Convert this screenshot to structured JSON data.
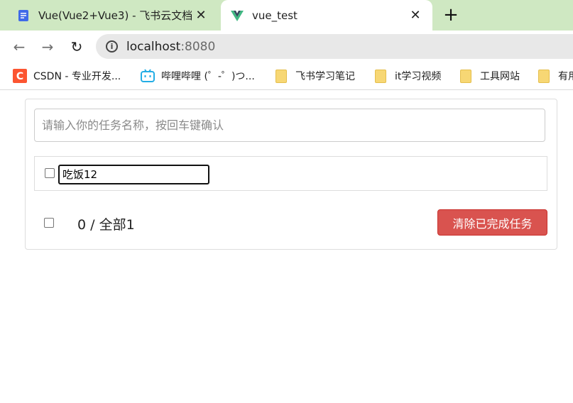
{
  "browser": {
    "tabs": [
      {
        "title": "Vue(Vue2+Vue3) - 飞书云文档",
        "close": "✕",
        "active": false
      },
      {
        "title": "vue_test",
        "close": "✕",
        "active": true
      }
    ],
    "new_tab": "+",
    "nav": {
      "back": "←",
      "forward": "→",
      "reload": "↻"
    },
    "url": {
      "host": "localhost",
      "port": ":8080"
    },
    "bookmarks": [
      {
        "label": "CSDN - 专业开发...",
        "icon": "csdn-icon"
      },
      {
        "label": "哔哩哔哩 (゜-゜)つ...",
        "icon": "bilibili-icon"
      },
      {
        "label": "飞书学习笔记",
        "icon": "folder-icon"
      },
      {
        "label": "it学习视频",
        "icon": "folder-icon"
      },
      {
        "label": "工具网站",
        "icon": "folder-icon"
      },
      {
        "label": "有用",
        "icon": "folder-icon"
      }
    ]
  },
  "todo": {
    "input_placeholder": "请输入你的任务名称，按回车键确认",
    "items": [
      {
        "name": "吃饭12",
        "done": false,
        "editing": true
      }
    ],
    "footer": {
      "counter": "0 / 全部1",
      "clear_label": "清除已完成任务"
    }
  },
  "colors": {
    "tab_strip": "#cfe8c2",
    "danger": "#d9534f"
  }
}
